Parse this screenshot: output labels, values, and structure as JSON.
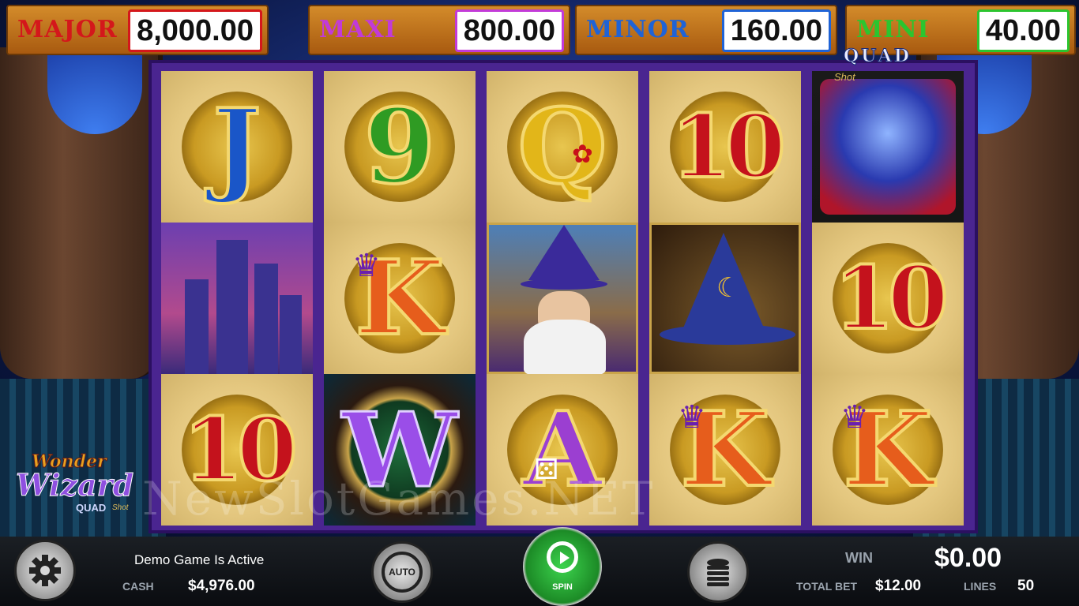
{
  "jackpots": [
    {
      "name": "MAJOR",
      "value": "8,000.00",
      "color": "#d4171b",
      "border": "#d4171b"
    },
    {
      "name": "MAXI",
      "value": "800.00",
      "color": "#c23ad8",
      "border": "#c23ad8"
    },
    {
      "name": "MINOR",
      "value": "160.00",
      "color": "#1f63d6",
      "border": "#1f63d6"
    },
    {
      "name": "MINI",
      "value": "40.00",
      "color": "#2bc52f",
      "border": "#2bc52f"
    }
  ],
  "reels": {
    "row1": [
      "J",
      "9",
      "Q",
      "10",
      "crystal-ball"
    ],
    "row2": [
      "castle",
      "K",
      "wizard",
      "wizard-hat",
      "10"
    ],
    "row3": [
      "10",
      "W",
      "A",
      "K",
      "K"
    ]
  },
  "symbols": {
    "j": "J",
    "nine": "9",
    "q": "Q",
    "ten": "10",
    "k": "K",
    "a": "A",
    "w": "W"
  },
  "quad_shot": {
    "quad": "QUAD",
    "shot": "Shot"
  },
  "logo": {
    "line1": "Wonder",
    "line2": "Wizard",
    "line3": "QUAD",
    "line4": "Shot"
  },
  "watermark": "NewSlotGames.NET",
  "bottom": {
    "status": "Demo Game Is Active",
    "cash_label": "CASH",
    "cash_value": "$4,976.00",
    "auto_label": "AUTO",
    "spin_label": "SPIN",
    "win_label": "WIN",
    "win_value": "$0.00",
    "total_bet_label": "TOTAL BET",
    "total_bet_value": "$12.00",
    "lines_label": "LINES",
    "lines_value": "50"
  }
}
